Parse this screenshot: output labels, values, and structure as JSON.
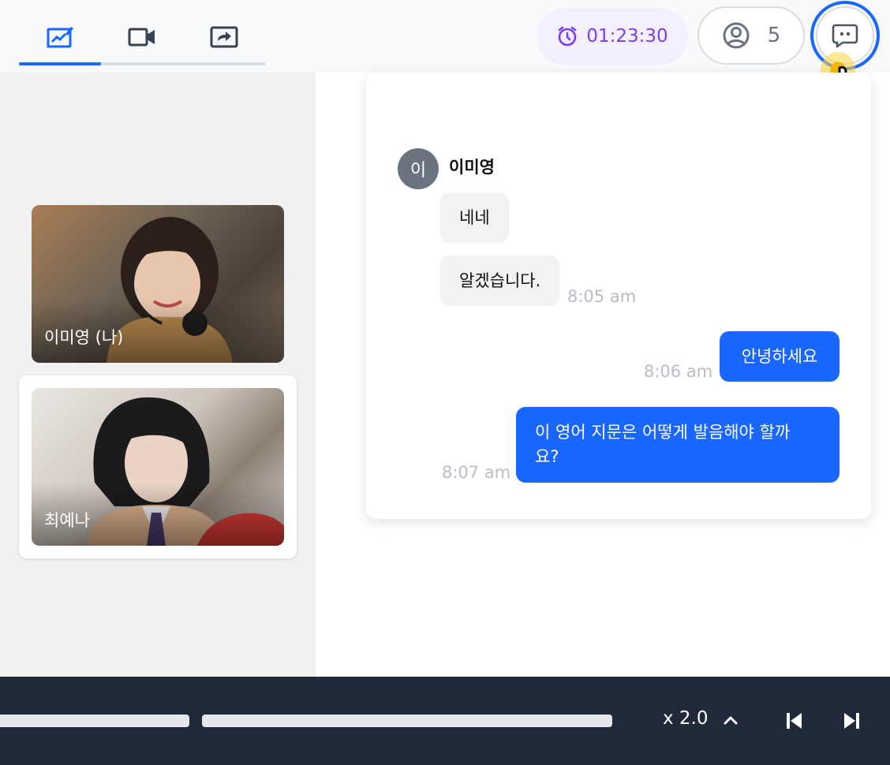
{
  "topbar": {
    "tabs": [
      {
        "name": "whiteboard",
        "icon": "chart-pen-icon",
        "active": true
      },
      {
        "name": "video",
        "icon": "video-camera-icon",
        "active": false
      },
      {
        "name": "screen-share",
        "icon": "share-screen-icon",
        "active": false
      }
    ],
    "timer": {
      "icon": "alarm-clock-icon",
      "value": "01:23:30"
    },
    "participants": {
      "icon": "user-circle-icon",
      "count": "5"
    },
    "chat_button": {
      "icon": "chat-bubble-icon"
    }
  },
  "videos": [
    {
      "name": "이미영 (나)"
    },
    {
      "name": "최예나"
    }
  ],
  "chat": {
    "sender": {
      "avatar_initial": "이",
      "name": "이미영"
    },
    "incoming": [
      {
        "text": "네네"
      },
      {
        "text": "알겠습니다.",
        "time": "8:05 am"
      }
    ],
    "outgoing": [
      {
        "text": "안녕하세요",
        "time": "8:06 am"
      },
      {
        "text_line1": "이 영어 지문은 어떻게 발음해야 할까",
        "text_line2": "요?",
        "time": "8:07 am"
      }
    ]
  },
  "player": {
    "speed": "x 2.0",
    "icons": {
      "speed_up": "chevron-up-icon",
      "prev": "skip-previous-icon",
      "next": "skip-next-icon"
    }
  },
  "colors": {
    "accent": "#1967ff",
    "timer": "#7b3ff2",
    "bottombar": "#20293a"
  }
}
